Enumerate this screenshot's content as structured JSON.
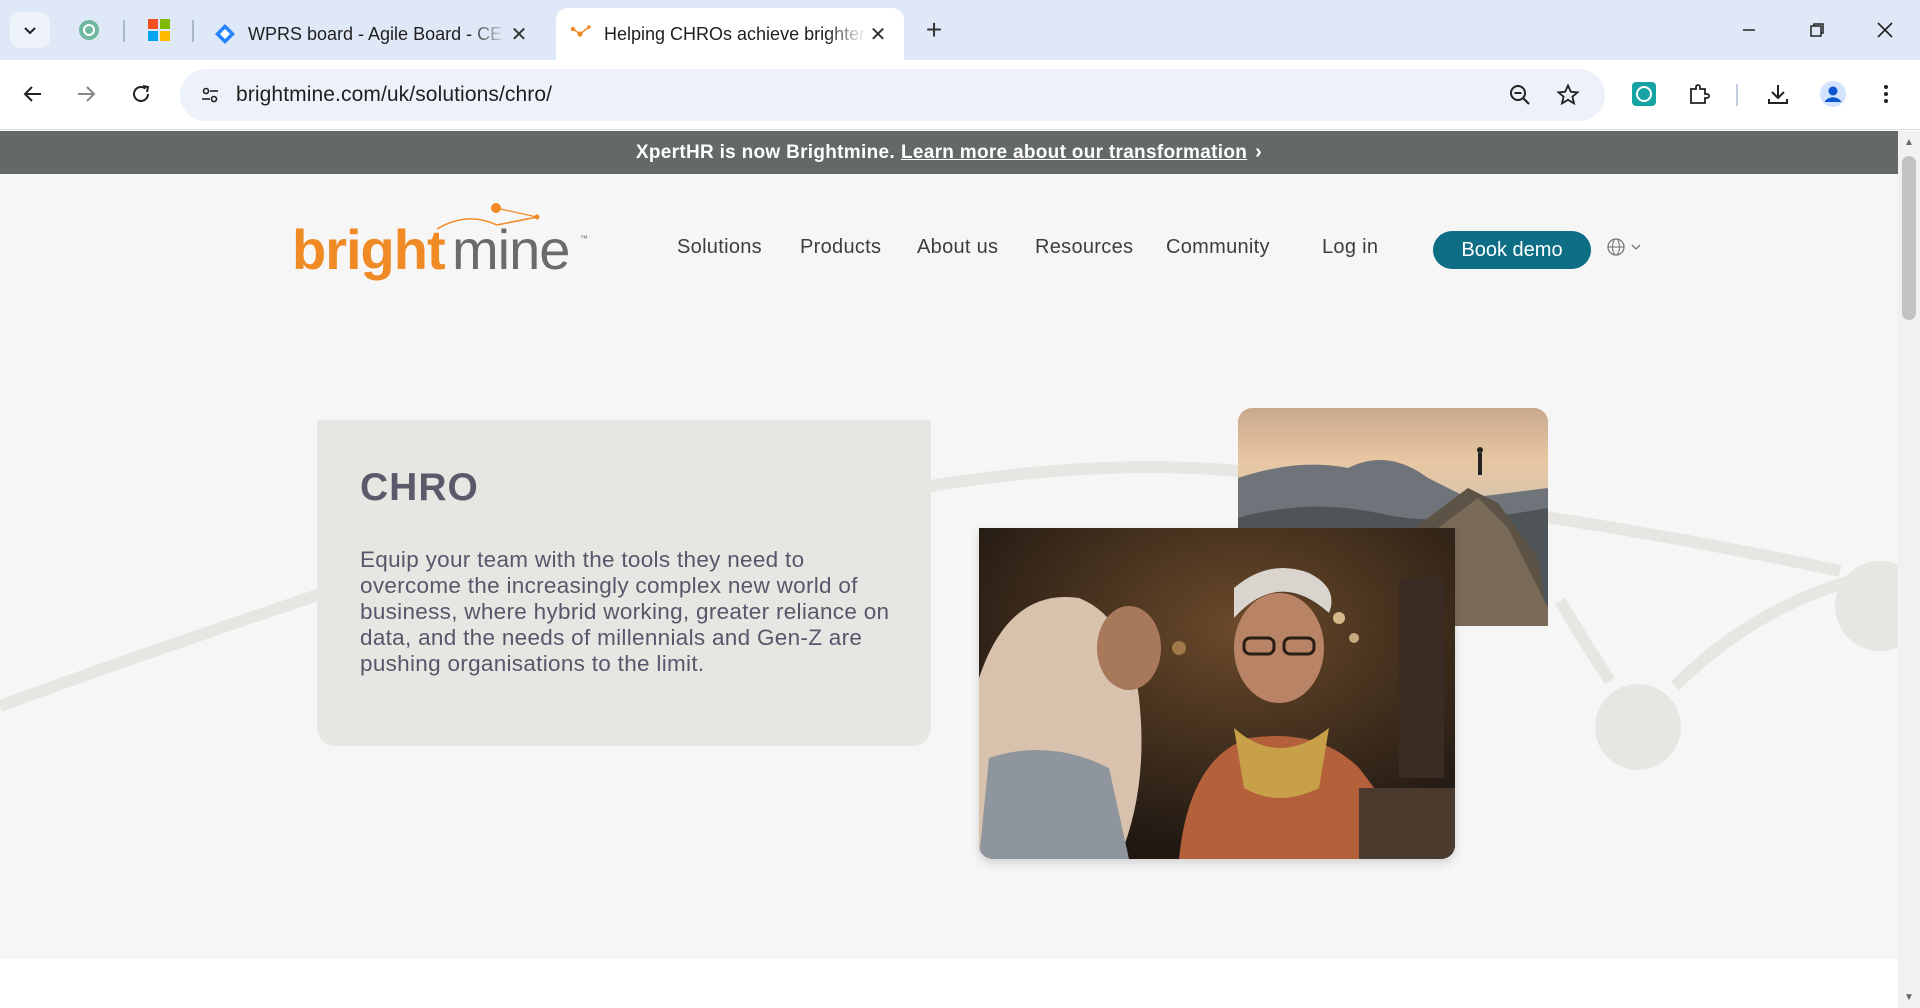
{
  "browser": {
    "tabs": [
      {
        "title": "WPRS board - Agile Board - CE",
        "icon": "jira-diamond-icon"
      },
      {
        "title": "Helping CHROs achieve brighter",
        "icon": "brightmine-favicon"
      }
    ],
    "url": "brightmine.com/uk/solutions/chro/"
  },
  "banner": {
    "text": "XpertHR is now Brightmine.",
    "link": "Learn more about our transformation"
  },
  "header": {
    "logo_alt": "brightmine",
    "nav": [
      "Solutions",
      "Products",
      "About us",
      "Resources",
      "Community"
    ],
    "login": "Log in",
    "cta": "Book demo"
  },
  "hero": {
    "title": "CHRO",
    "body": "Equip your team with the tools they need to overcome the increasingly complex new world of business, where hybrid working, greater reliance on data, and the needs of millennials and Gen-Z are pushing organisations to the limit."
  },
  "colors": {
    "brand_orange": "#f08a24",
    "brand_teal": "#0d6e86",
    "banner_bg": "#636869"
  }
}
